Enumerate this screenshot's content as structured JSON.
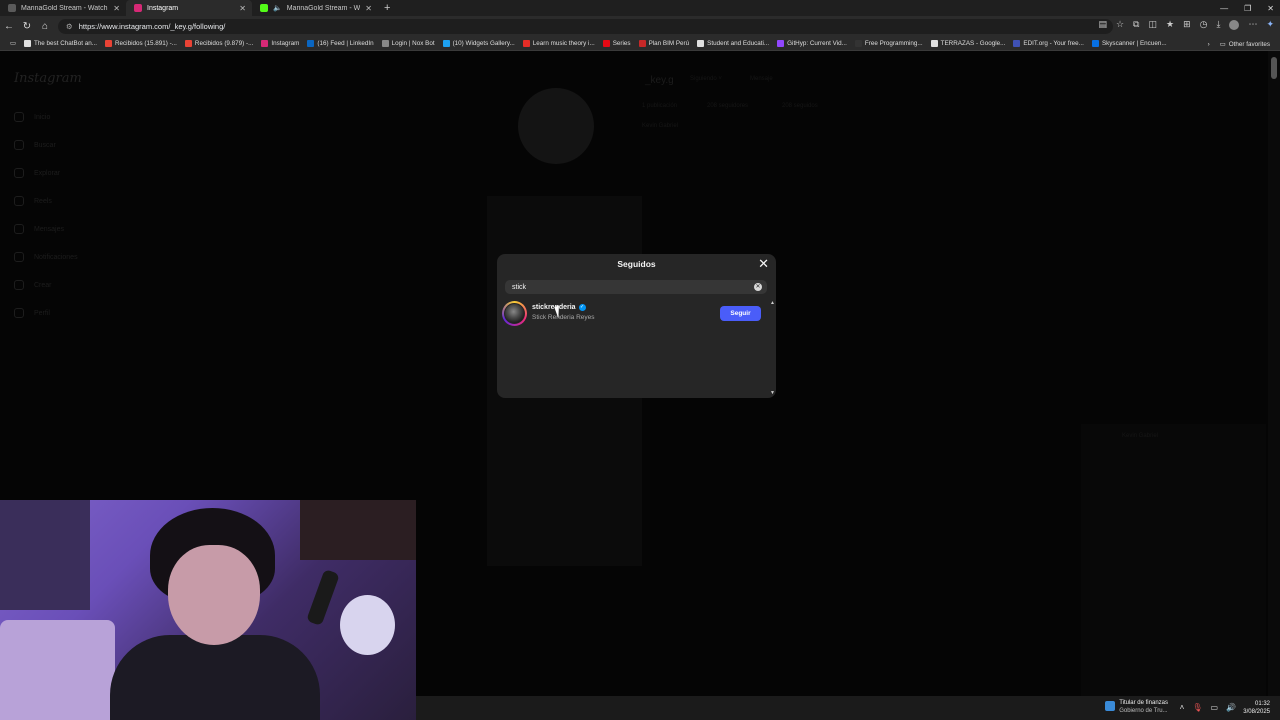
{
  "browser": {
    "tabs": [
      {
        "title": "MarinaGold Stream - Watch Live o",
        "color": "#5a5a5a"
      },
      {
        "title": "Instagram",
        "color": "#d62976"
      },
      {
        "title": "MarinaGold Stream - Watch",
        "color": "#53fc18"
      }
    ],
    "url": "https://www.instagram.com/_key.g/following/",
    "bookmarks": [
      {
        "label": "The best ChatBot an...",
        "color": "#e0e0e0"
      },
      {
        "label": "Recibidos (15.891) -...",
        "color": "#ea4335"
      },
      {
        "label": "Recibidos (9.879) -...",
        "color": "#ea4335"
      },
      {
        "label": "Instagram",
        "color": "#d62976"
      },
      {
        "label": "(16) Feed | LinkedIn",
        "color": "#0a66c2"
      },
      {
        "label": "Login | Nox Bot",
        "color": "#888888"
      },
      {
        "label": "(10) Widgets Gallery...",
        "color": "#1da1f2"
      },
      {
        "label": "Learn music theory i...",
        "color": "#e52d27"
      },
      {
        "label": "Series",
        "color": "#e50914"
      },
      {
        "label": "Plan BIM Perú",
        "color": "#c62828"
      },
      {
        "label": "Student and Educati...",
        "color": "#e0e0e0"
      },
      {
        "label": "GitHyp: Current Vid...",
        "color": "#9147ff"
      },
      {
        "label": "Free Programming...",
        "color": "#333333"
      },
      {
        "label": "TERRAZAS - Google...",
        "color": "#e0e0e0"
      },
      {
        "label": "EDIT.org - Your free...",
        "color": "#3f51b5"
      },
      {
        "label": "Skyscanner | Encuen...",
        "color": "#0770e3"
      }
    ],
    "other_favorites": "Other favorites"
  },
  "instagram": {
    "logo": "Instagram",
    "sidebar": [
      "Inicio",
      "Buscar",
      "Explorar",
      "Reels",
      "Mensajes",
      "Notificaciones",
      "Crear",
      "Perfil"
    ],
    "profile": {
      "username": "_key.g",
      "following_button": "Siguiendo ˅",
      "message_button": "Mensaje",
      "stats": [
        "1 publicación",
        "208 seguidores",
        "208 seguidos"
      ],
      "name": "Kevin Gabriel"
    },
    "messenger": {
      "name": "Kevin Gabriel"
    }
  },
  "modal": {
    "title": "Seguidos",
    "search_value": "stick",
    "results": [
      {
        "username": "stickrenderia",
        "full_name": "Stick Renderia Reyes",
        "button": "Seguir",
        "verified": true
      }
    ]
  },
  "taskbar": {
    "widget_title": "Titular de finanzas",
    "widget_sub": "Gobierno de Tru...",
    "time": "01:32",
    "date": "3/08/2025"
  }
}
